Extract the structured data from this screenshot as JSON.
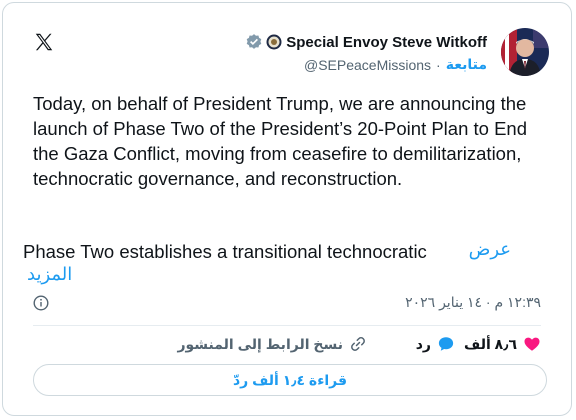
{
  "author": {
    "name": "Special Envoy Steve Witkoff",
    "handle": "@SEPeaceMissions",
    "follow_label": "متابعة",
    "dot": "·"
  },
  "tweet": {
    "text": "Today, on behalf of President Trump, we are announcing the launch of Phase Two of the President’s 20-Point Plan to End the Gaza Conflict, moving from ceasefire to demilitarization, technocratic governance, and reconstruction.",
    "text2": "Phase Two establishes a transitional technocratic",
    "show_more_a": "عرض",
    "show_more_b": "المزيد",
    "timestamp": "١٢:٣٩ م · ١٤ يناير ٢٠٢٦"
  },
  "actions": {
    "likes": "٨٫٦ ألف",
    "reply": "رد",
    "copy_link": "نسخ الرابط إلى المنشور"
  },
  "read_replies": "قراءة ١٫٤ ألف ردّ",
  "colors": {
    "accent": "#1d9bf0",
    "like": "#f91880",
    "text": "#0f1419",
    "muted": "#536471"
  },
  "icons": [
    "x-logo-icon",
    "verified-badge-icon",
    "seal-icon",
    "info-icon",
    "heart-icon",
    "reply-icon",
    "link-icon"
  ]
}
